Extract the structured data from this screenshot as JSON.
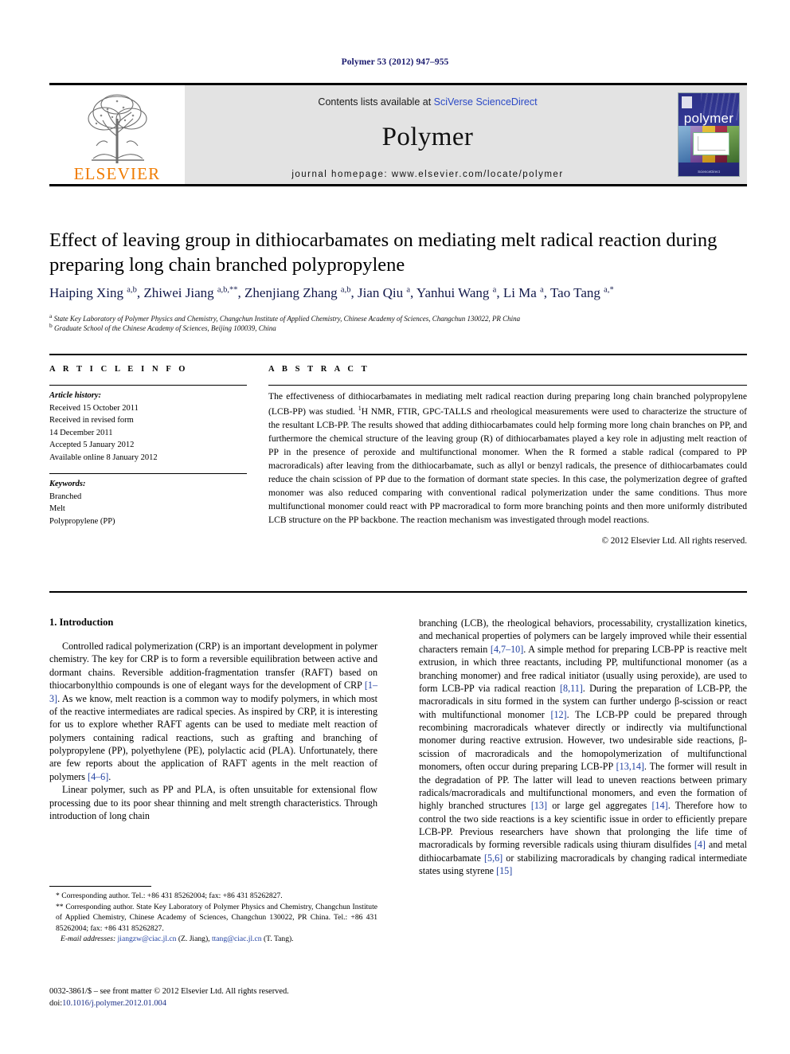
{
  "running_head": "Polymer 53 (2012) 947–955",
  "masthead": {
    "publisher_logo_name": "elsevier-tree-logo",
    "publisher_word": "ELSEVIER",
    "contents_prefix": "Contents lists available at ",
    "contents_link": "SciVerse ScienceDirect",
    "journal_name": "Polymer",
    "homepage": "journal homepage: www.elsevier.com/locate/polymer",
    "cover_title": "polymer",
    "cover_footer": "ScienceDirect"
  },
  "article": {
    "title": "Effect of leaving group in dithiocarbamates on mediating melt radical reaction during preparing long chain branched polypropylene",
    "authors": "Haiping Xing a,b, Zhiwei Jiang a,b,**, Zhenjiang Zhang a,b, Jian Qiu a, Yanhui Wang a, Li Ma a, Tao Tang a,*",
    "affiliation_a": "State Key Laboratory of Polymer Physics and Chemistry, Changchun Institute of Applied Chemistry, Chinese Academy of Sciences, Changchun 130022, PR China",
    "affiliation_b": "Graduate School of the Chinese Academy of Sciences, Beijing 100039, China"
  },
  "headers": {
    "article_info": "A R T I C L E  I N F O",
    "abstract": "A B S T R A C T"
  },
  "article_info": {
    "history_label": "Article history:",
    "history": [
      "Received 15 October 2011",
      "Received in revised form",
      "14 December 2011",
      "Accepted 5 January 2012",
      "Available online 8 January 2012"
    ],
    "keywords_label": "Keywords:",
    "keywords": [
      "Branched",
      "Melt",
      "Polypropylene (PP)"
    ]
  },
  "abstract": {
    "part1": "The effectiveness of dithiocarbamates in mediating melt radical reaction during preparing long chain branched polypropylene (LCB-PP) was studied. ",
    "sup": "1",
    "part2": "H NMR, FTIR, GPC-TALLS and rheological measurements were used to characterize the structure of the resultant LCB-PP. The results showed that adding dithiocarbamates could help forming more long chain branches on PP, and furthermore the chemical structure of the leaving group (R) of dithiocarbamates played a key role in adjusting melt reaction of PP in the presence of peroxide and multifunctional monomer. When the R formed a stable radical (compared to PP macroradicals) after leaving from the dithiocarbamate, such as allyl or benzyl radicals, the presence of dithiocarbamates could reduce the chain scission of PP due to the formation of dormant state species. In this case, the polymerization degree of grafted monomer was also reduced comparing with conventional radical polymerization under the same conditions. Thus more multifunctional monomer could react with PP macroradical to form more branching points and then more uniformly distributed LCB structure on the PP backbone. The reaction mechanism was investigated through model reactions.",
    "copyright": "© 2012 Elsevier Ltd. All rights reserved."
  },
  "body": {
    "section_heading": "1. Introduction",
    "left_p1_a": "Controlled radical polymerization (CRP) is an important development in polymer chemistry. The key for CRP is to form a reversible equilibration between active and dormant chains. Reversible addition-fragmentation transfer (RAFT) based on thiocarbonylthio compounds is one of elegant ways for the development of CRP ",
    "left_p1_ref1": "[1–3]",
    "left_p1_b": ". As we know, melt reaction is a common way to modify polymers, in which most of the reactive intermediates are radical species. As inspired by CRP, it is interesting for us to explore whether RAFT agents can be used to mediate melt reaction of polymers containing radical reactions, such as grafting and branching of polypropylene (PP), polyethylene (PE), polylactic acid (PLA). Unfortunately, there are few reports about the application of RAFT agents in the melt reaction of polymers ",
    "left_p1_ref2": "[4–6]",
    "left_p1_c": ".",
    "left_p2": "Linear polymer, such as PP and PLA, is often unsuitable for extensional flow processing due to its poor shear thinning and melt strength characteristics. Through introduction of long chain",
    "right_a": "branching (LCB), the rheological behaviors, processability, crystallization kinetics, and mechanical properties of polymers can be largely improved while their essential characters remain ",
    "right_ref1": "[4,7–10]",
    "right_b": ". A simple method for preparing LCB-PP is reactive melt extrusion, in which three reactants, including PP, multifunctional monomer (as a branching monomer) and free radical initiator (usually using peroxide), are used to form LCB-PP via radical reaction ",
    "right_ref2": "[8,11]",
    "right_c": ". During the preparation of LCB-PP, the macroradicals in situ formed in the system can further undergo β-scission or react with multifunctional monomer ",
    "right_ref3": "[12]",
    "right_d": ". The LCB-PP could be prepared through recombining macroradicals whatever directly or indirectly via multifunctional monomer during reactive extrusion. However, two undesirable side reactions, β-scission of macroradicals and the homopolymerization of multifunctional monomers, often occur during preparing LCB-PP ",
    "right_ref4": "[13,14]",
    "right_e": ". The former will result in the degradation of PP. The latter will lead to uneven reactions between primary radicals/macroradicals and multifunctional monomers, and even the formation of highly branched structures ",
    "right_ref5": "[13]",
    "right_f": " or large gel aggregates ",
    "right_ref6": "[14]",
    "right_g": ". Therefore how to control the two side reactions is a key scientific issue in order to efficiently prepare LCB-PP. Previous researchers have shown that prolonging the life time of macroradicals by forming reversible radicals using thiuram disulfides ",
    "right_ref7": "[4]",
    "right_h": " and metal dithiocarbamate ",
    "right_ref8": "[5,6]",
    "right_i": " or stabilizing macroradicals by changing radical intermediate states using styrene ",
    "right_ref9": "[15]"
  },
  "footnotes": {
    "star1": "* Corresponding author. Tel.: +86 431 85262004; fax: +86 431 85262827.",
    "star2": "** Corresponding author. State Key Laboratory of Polymer Physics and Chemistry, Changchun Institute of Applied Chemistry, Chinese Academy of Sciences, Changchun 130022, PR China. Tel.: +86 431 85262004; fax: +86 431 85262827.",
    "email_label": "E-mail addresses:",
    "email1": "jiangzw@ciac.jl.cn",
    "email1_name": " (Z. Jiang), ",
    "email2": "ttang@ciac.jl.cn",
    "email2_name": " (T. Tang)."
  },
  "imprint": {
    "issn_line": "0032-3861/$ – see front matter © 2012 Elsevier Ltd. All rights reserved.",
    "doi_label": "doi:",
    "doi_value": "10.1016/j.polymer.2012.01.004"
  },
  "colors": {
    "running_head": "#1a1a6e",
    "link": "#2b49c6",
    "reference": "#1f3fa0",
    "elsevier_orange": "#f07c00",
    "band_gray": "#e3e3e3"
  }
}
